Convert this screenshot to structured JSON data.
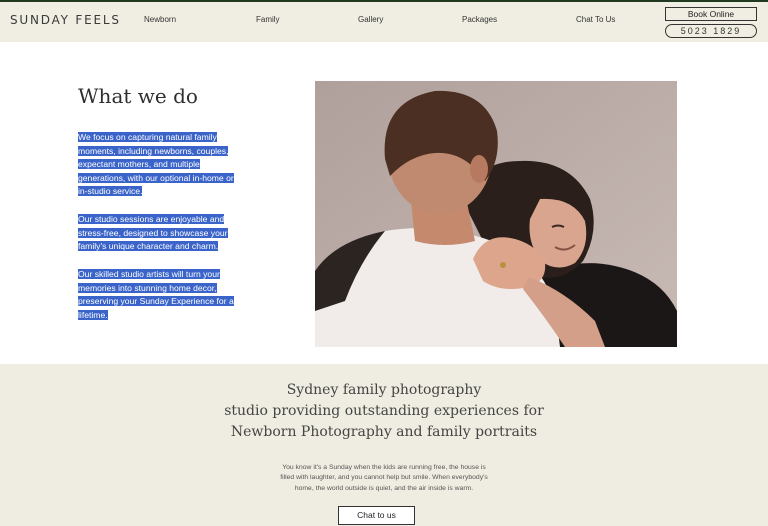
{
  "nav": {
    "logo": "SUNDAY FEELS",
    "links": [
      "Newborn",
      "Family",
      "Gallery",
      "Packages",
      "Chat To Us"
    ],
    "book_label": "Book Online",
    "phone": "5023 1829"
  },
  "about": {
    "title": "What we do",
    "paragraphs": [
      [
        "We focus on capturing natural family",
        "moments, including newborns, couples,",
        "expectant mothers, and multiple",
        "generations, with our optional in-home or",
        "in-studio service."
      ],
      [
        "Our studio sessions are enjoyable and",
        "stress-free, designed to showcase your",
        "family's unique character and charm."
      ],
      [
        "Our skilled studio artists will turn your",
        "memories into stunning home decor,",
        "preserving your Sunday Experience for a",
        "lifetime."
      ]
    ]
  },
  "intro": {
    "headline": [
      "Sydney family photography",
      "studio providing outstanding experiences for",
      "Newborn Photography and family portraits"
    ],
    "body": [
      "You know it's a Sunday when the kids are running free, the house is",
      "filled with laughter, and you cannot help but smile. When everybody's",
      "home, the world outside is quiet, and the air inside is warm."
    ],
    "cta_label": "Chat to us"
  },
  "colors": {
    "nav_bg": "#f0eee2",
    "band_bg": "#efede1",
    "selection": "#3a64c9"
  }
}
